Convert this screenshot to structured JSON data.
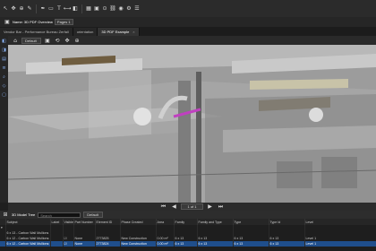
{
  "toolbar": {
    "icons": [
      "pointer-icon",
      "pan-icon",
      "zoom-icon",
      "markup-icon",
      "pen-icon",
      "shape-icon",
      "text-icon",
      "measure-icon",
      "layers-icon",
      "grid-icon",
      "cube-icon",
      "stamp-icon",
      "link-icon",
      "camera-icon",
      "settings-icon",
      "menu-icon"
    ]
  },
  "row2": {
    "name_label": "Name: 3D PDF Overview",
    "page_label": "Pages 1"
  },
  "tabs": [
    {
      "label": "Vendor Bar - Performance Bureau Zerfall"
    },
    {
      "label": "orientation"
    },
    {
      "label": "3D PDF Example"
    }
  ],
  "viewtool": {
    "mode": "Default"
  },
  "nav": {
    "page": "1 of 1"
  },
  "panel": {
    "title": "3D Model Tree",
    "search_placeholder": "Search",
    "view_value": "Default",
    "columns": [
      "",
      "Subject",
      "Label",
      "Visible",
      "Part Number",
      "Element ID",
      "Phase Created",
      "Area",
      "Family",
      "Family and Type",
      "Type",
      "Type Id",
      "Level"
    ],
    "rows": [
      {
        "cells": [
          "▾",
          "",
          "",
          "",
          "",
          "",
          "",
          "",
          "",
          "",
          "",
          "",
          ""
        ]
      },
      {
        "cells": [
          "",
          "6 x 13 - Carbon Wall Mullions",
          "",
          "",
          "",
          "",
          "",
          "",
          "",
          "",
          "",
          "",
          ""
        ]
      },
      {
        "cells": [
          "",
          "6 x 12 - Carbon Wall Mullions: 10 373825",
          "",
          "☑",
          "None",
          "2773825",
          "New Construction",
          "0.00 m²",
          "6 x 13",
          "6 x 13",
          "6 x 13",
          "6 x 13",
          "Level 1"
        ]
      },
      {
        "cells": [
          "",
          "6 x 12 - Carbon Wall Mullions: 10 373824",
          "",
          "☑",
          "None",
          "2773824",
          "New Construction",
          "0.00 m²",
          "6 x 13",
          "6 x 13",
          "6 x 13",
          "6 x 13",
          "Level 1"
        ]
      }
    ]
  }
}
